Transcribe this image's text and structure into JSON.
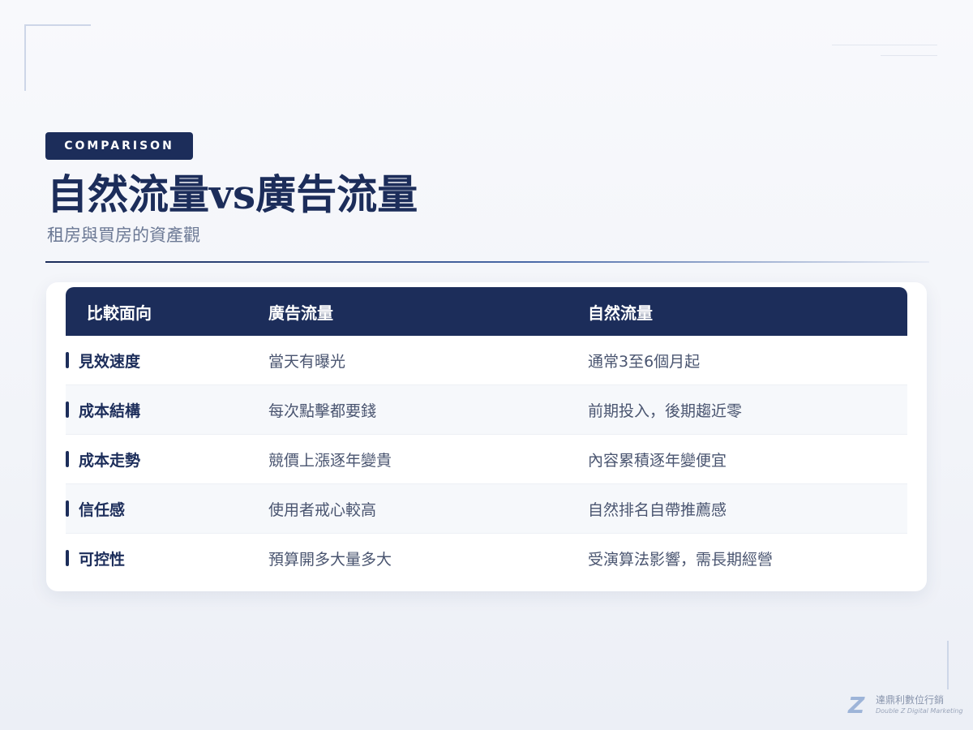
{
  "header": {
    "tag": "COMPARISON",
    "title": "自然流量vs廣告流量",
    "subtitle": "租房與買房的資產觀"
  },
  "table": {
    "columns": [
      "比較面向",
      "廣告流量",
      "自然流量"
    ],
    "rows": [
      {
        "aspect": "見效速度",
        "ads": "當天有曝光",
        "organic": "通常3至6個月起"
      },
      {
        "aspect": "成本結構",
        "ads": "每次點擊都要錢",
        "organic": "前期投入，後期趨近零"
      },
      {
        "aspect": "成本走勢",
        "ads": "競價上漲逐年變貴",
        "organic": "內容累積逐年變便宜"
      },
      {
        "aspect": "信任感",
        "ads": "使用者戒心較高",
        "organic": "自然排名自帶推薦感"
      },
      {
        "aspect": "可控性",
        "ads": "預算開多大量多大",
        "organic": "受演算法影響，需長期經營"
      }
    ]
  },
  "brand": {
    "logo_letter": "Z",
    "name": "達鼎利數位行銷",
    "name_en": "Double Z Digital Marketing"
  },
  "colors": {
    "primary": "#1c2d5a",
    "accent": "#4a6aa8",
    "muted_text": "#6b7894",
    "background": "#f4f6fa"
  }
}
